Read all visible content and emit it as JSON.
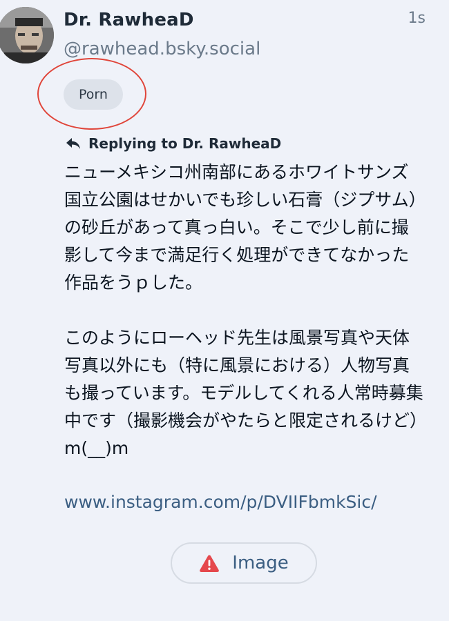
{
  "post": {
    "author": {
      "display_name": "Dr. RawheaD",
      "handle": "@rawhead.bsky.social"
    },
    "timestamp": "1s",
    "content_label": "Porn",
    "reply_to": "Replying to Dr. RawheaD",
    "body_paragraphs": [
      "ニューメキシコ州南部にあるホワイトサンズ国立公園はせかいでも珍しい石膏（ジプサム）の砂丘があって真っ白い。そこで少し前に撮影して今まで満足行く処理ができてなかった作品をうｐした。",
      "このようにローヘッド先生は風景写真や天体写真以外にも（特に風景における）人物写真も撮っています。モデルしてくれる人常時募集中です（撮影機会がやたらと限定されるけど）m(__)m"
    ],
    "link_text": "www.instagram.com/p/DVIIFbmkSic/",
    "media_button_label": "Image"
  },
  "colors": {
    "background": "#eff2f9",
    "link": "#3b5e82",
    "warning_icon": "#e5484d",
    "annotation": "#e0453a"
  },
  "icons": {
    "reply": "reply-arrow-icon",
    "warning": "warning-triangle-icon"
  }
}
